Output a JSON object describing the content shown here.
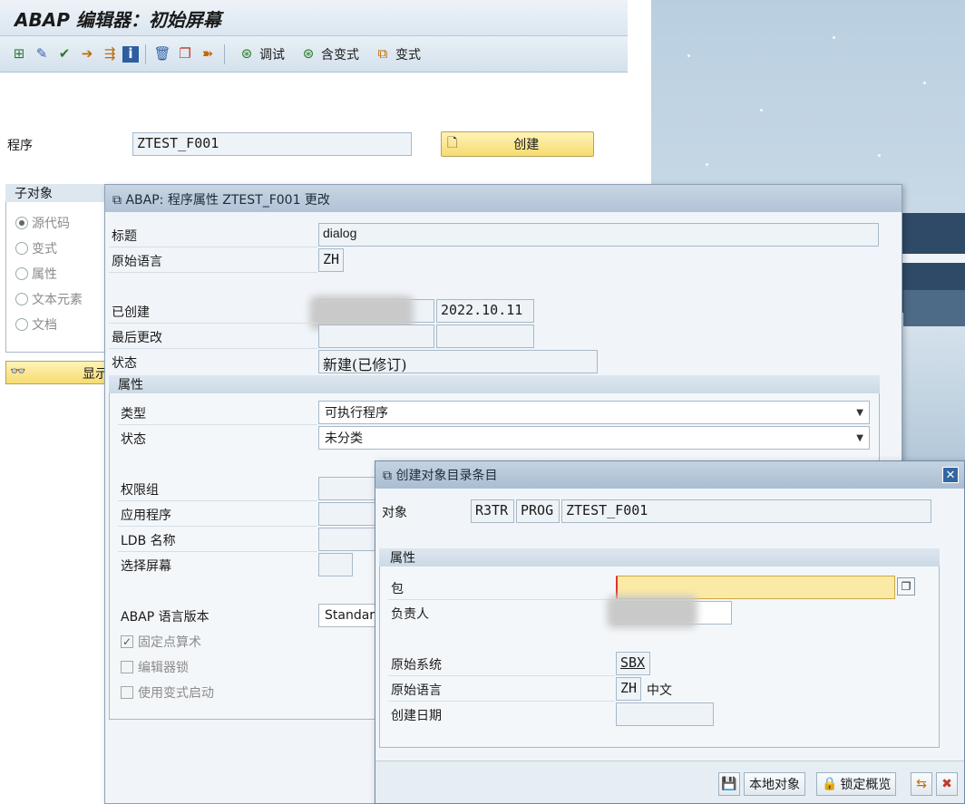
{
  "main": {
    "title": "ABAP 编辑器：初始屏幕",
    "toolbar": {
      "debug_label": "调试",
      "with_variant_label": "含变式",
      "variant_label": "变式"
    },
    "program_label": "程序",
    "program_value": "ZTEST_F001",
    "create_label": "创建",
    "subobjects": {
      "title": "子对象",
      "items": [
        "源代码",
        "变式",
        "属性",
        "文本元素",
        "文档"
      ]
    },
    "display_label": "显示"
  },
  "attr_dialog": {
    "title": "ABAP: 程序属性 ZTEST_F001 更改",
    "title_label": "标题",
    "title_value": "dialog",
    "orig_lang_label": "原始语言",
    "orig_lang_value": "ZH",
    "created_label": "已创建",
    "created_date": "2022.10.11",
    "last_changed_label": "最后更改",
    "status_label": "状态",
    "status_value": "新建(已修订)",
    "attributes": {
      "title": "属性",
      "type_label": "类型",
      "type_value": "可执行程序",
      "status_label": "状态",
      "status_value": "未分类",
      "auth_group_label": "权限组",
      "application_label": "应用程序",
      "ldb_name_label": "LDB 名称",
      "selection_screen_label": "选择屏幕",
      "abap_version_label": "ABAP 语言版本",
      "abap_version_value": "Standard",
      "fixed_point_label": "固定点算术",
      "fixed_point_checked": true,
      "editor_lock_label": "编辑器锁",
      "editor_lock_checked": false,
      "variant_start_label": "使用变式启动",
      "variant_start_checked": false
    }
  },
  "tadir_dialog": {
    "title": "创建对象目录条目",
    "object_label": "对象",
    "object_pgmid": "R3TR",
    "object_type": "PROG",
    "object_name": "ZTEST_F001",
    "attributes_title": "属性",
    "package_label": "包",
    "package_value": "",
    "responsible_label": "负责人",
    "orig_system_label": "原始系统",
    "orig_system_value": "SBX",
    "orig_lang_label": "原始语言",
    "orig_lang_value": "ZH",
    "orig_lang_text": "中文",
    "created_date_label": "创建日期",
    "created_date_value": "",
    "local_object_label": "本地对象",
    "lock_overview_label": "锁定概览"
  },
  "colors": {
    "accent_yellow": "#f6dc70",
    "title_blue": "#b1c3d6",
    "close_blue": "#3466a0"
  }
}
